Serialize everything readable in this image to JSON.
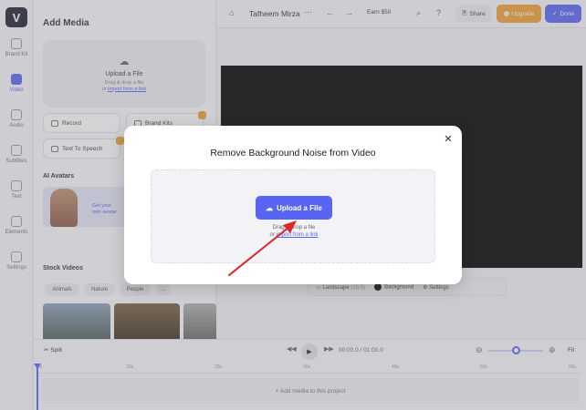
{
  "rail": {
    "logo": "V",
    "items": [
      {
        "label": "Brand Kit",
        "icon": "brand-icon"
      },
      {
        "label": "Video",
        "icon": "video-icon",
        "active": true
      },
      {
        "label": "Audio",
        "icon": "audio-icon"
      },
      {
        "label": "Subtitles",
        "icon": "subtitles-icon"
      },
      {
        "label": "Text",
        "icon": "text-icon"
      },
      {
        "label": "Elements",
        "icon": "elements-icon"
      },
      {
        "label": "Settings",
        "icon": "settings-icon"
      }
    ]
  },
  "panel": {
    "title": "Add Media",
    "upload_title": "Upload a File",
    "upload_hint": "Drag & drop a file",
    "upload_link_prefix": "or",
    "upload_link": "import from a link",
    "record": "Record",
    "brand_kits": "Brand Kits",
    "tts": "Text To Speech",
    "avatars_title": "AI Avatars",
    "avatar_cta_line1": "Get your",
    "avatar_cta_line2": "own avatar",
    "stock_title": "Stock Videos",
    "stock_tags": [
      "Animals",
      "Nature",
      "People",
      "..."
    ]
  },
  "topbar": {
    "project_name": "Tafheem Mirza",
    "earn": "Earn $50",
    "share": "Share",
    "upgrade": "Upgrade",
    "done": "Done"
  },
  "canvas_bar": {
    "aspect": "Landscape",
    "aspect_ratio": "(16:9)",
    "background": "Background",
    "settings": "Settings"
  },
  "timeline": {
    "split": "Split",
    "current_time": "00:00.0",
    "separator": "/",
    "total_time": "01:00.0",
    "fit": "Fit",
    "ruler": [
      "0s",
      "10s",
      "20s",
      "30s",
      "40s",
      "50s",
      "60s"
    ],
    "add_media": "+ Add media to this project",
    "zoom_level": 0.5
  },
  "modal": {
    "title": "Remove Background Noise from Video",
    "upload_button": "Upload a File",
    "drag_hint": "Drag & drop a file",
    "link_prefix": "or",
    "link": "import from a link"
  },
  "colors": {
    "accent": "#5865f2",
    "upgrade": "#f0a030",
    "annotation": "#d9282f"
  }
}
